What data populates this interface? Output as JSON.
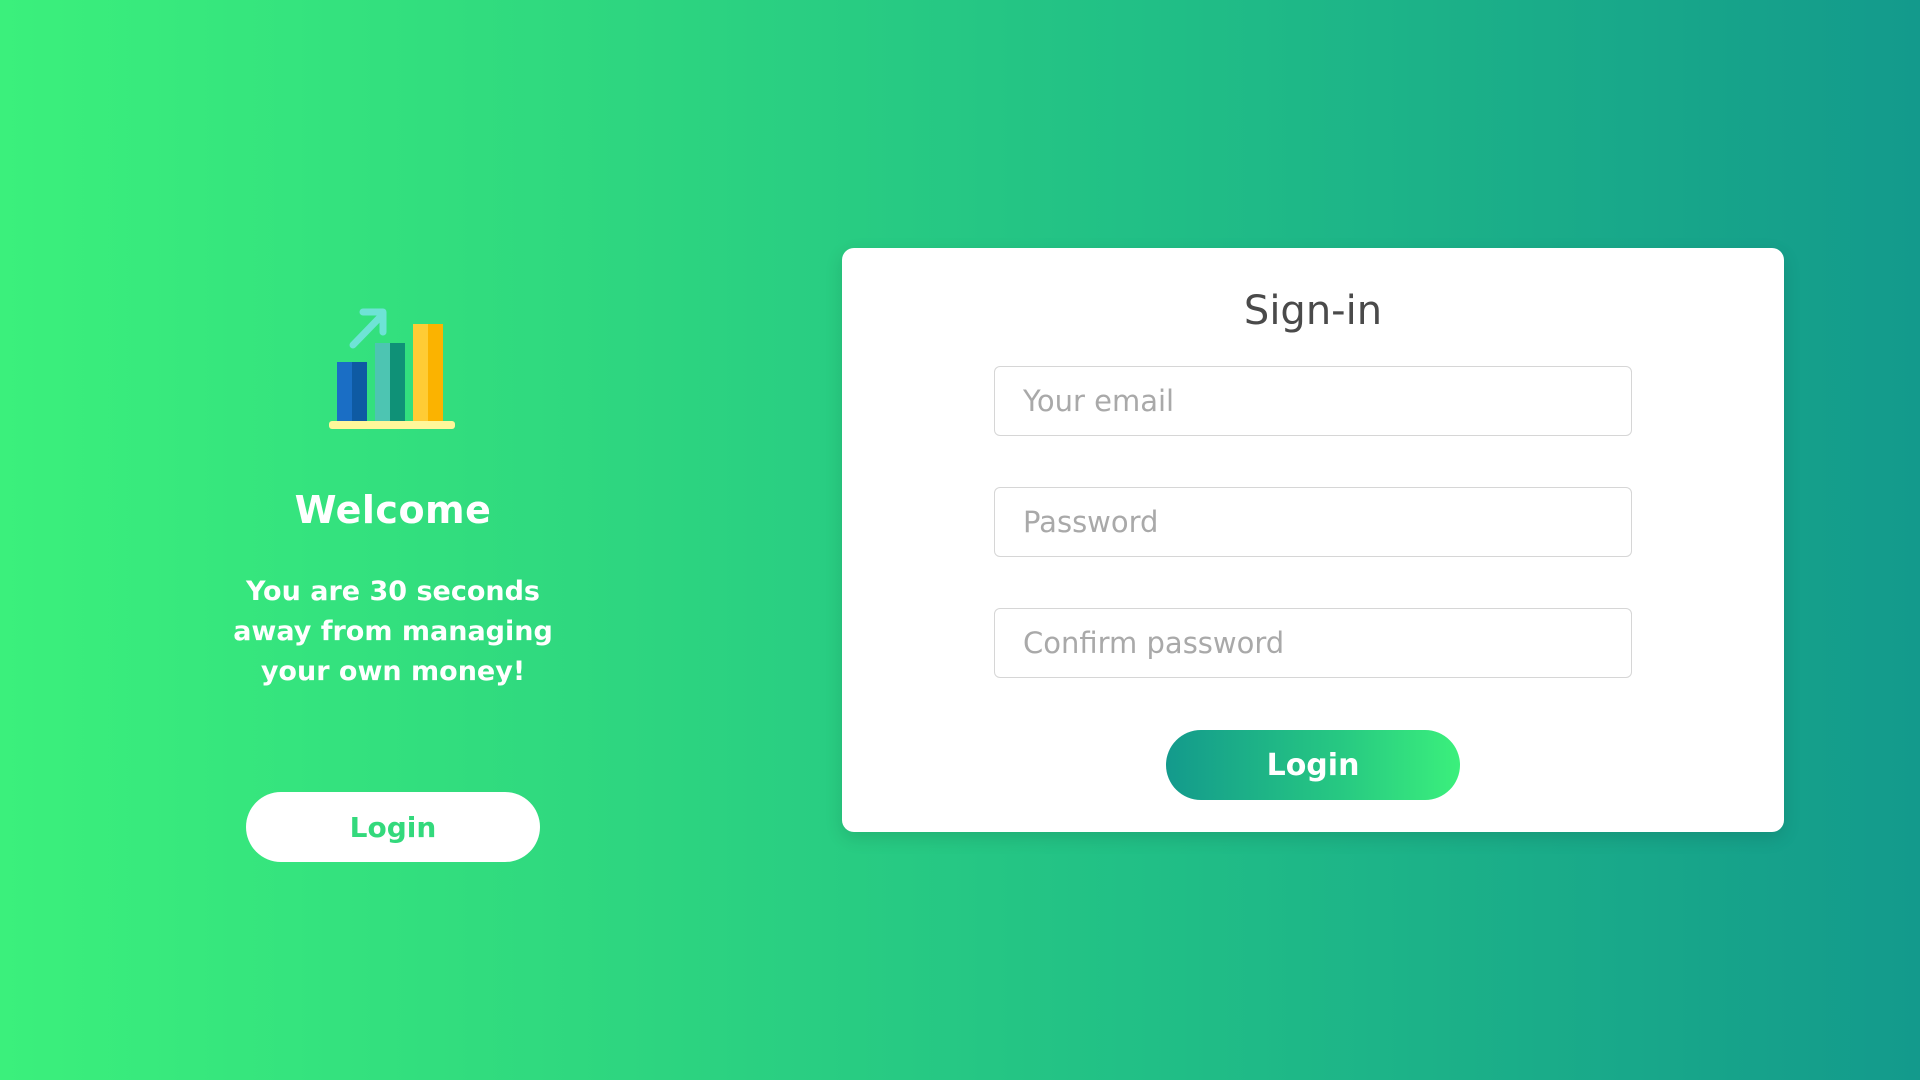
{
  "welcome": {
    "logo_icon": "bar-chart-growth-icon",
    "title": "Welcome",
    "text": "You are 30 seconds away from managing your own money!",
    "login_label": "Login"
  },
  "signin": {
    "title": "Sign-in",
    "email_placeholder": "Your email",
    "password_placeholder": "Password",
    "confirm_placeholder": "Confirm password",
    "login_label": "Login"
  },
  "colors": {
    "gradient_start": "#3bf07c",
    "gradient_end": "#139a8c",
    "card_background": "#ffffff",
    "accent_text": "#33d97c"
  }
}
